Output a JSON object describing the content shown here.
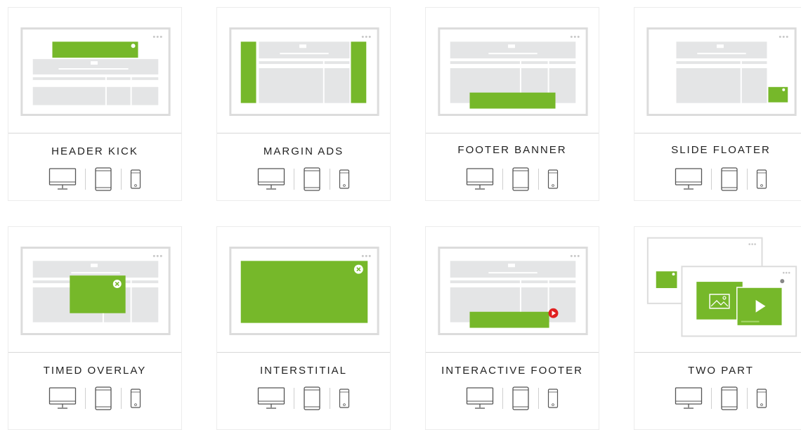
{
  "accent_color": "#76b82a",
  "placeholder_color": "#e4e5e6",
  "frame_color": "#dcdcdc",
  "cards": [
    {
      "title": "HEADER KICK",
      "layout": "header-kick",
      "devices": [
        "desktop-icon",
        "tablet-icon",
        "phone-icon"
      ]
    },
    {
      "title": "MARGIN ADS",
      "layout": "margin-ads",
      "devices": [
        "desktop-icon",
        "tablet-icon",
        "phone-icon"
      ]
    },
    {
      "title": "FOOTER BANNER",
      "layout": "footer-banner",
      "devices": [
        "desktop-icon",
        "tablet-icon",
        "phone-icon"
      ]
    },
    {
      "title": "SLIDE FLOATER",
      "layout": "slide-floater",
      "devices": [
        "desktop-icon",
        "tablet-icon",
        "phone-icon"
      ]
    },
    {
      "title": "TIMED OVERLAY",
      "layout": "timed-overlay",
      "devices": [
        "desktop-icon",
        "tablet-icon",
        "phone-icon"
      ]
    },
    {
      "title": "INTERSTITIAL",
      "layout": "interstitial",
      "devices": [
        "desktop-icon",
        "tablet-icon",
        "phone-icon"
      ]
    },
    {
      "title": "INTERACTIVE FOOTER",
      "layout": "interactive-footer",
      "devices": [
        "desktop-icon",
        "tablet-icon",
        "phone-icon"
      ]
    },
    {
      "title": "TWO PART",
      "layout": "two-part",
      "devices": [
        "desktop-icon",
        "tablet-icon",
        "phone-icon"
      ]
    }
  ]
}
